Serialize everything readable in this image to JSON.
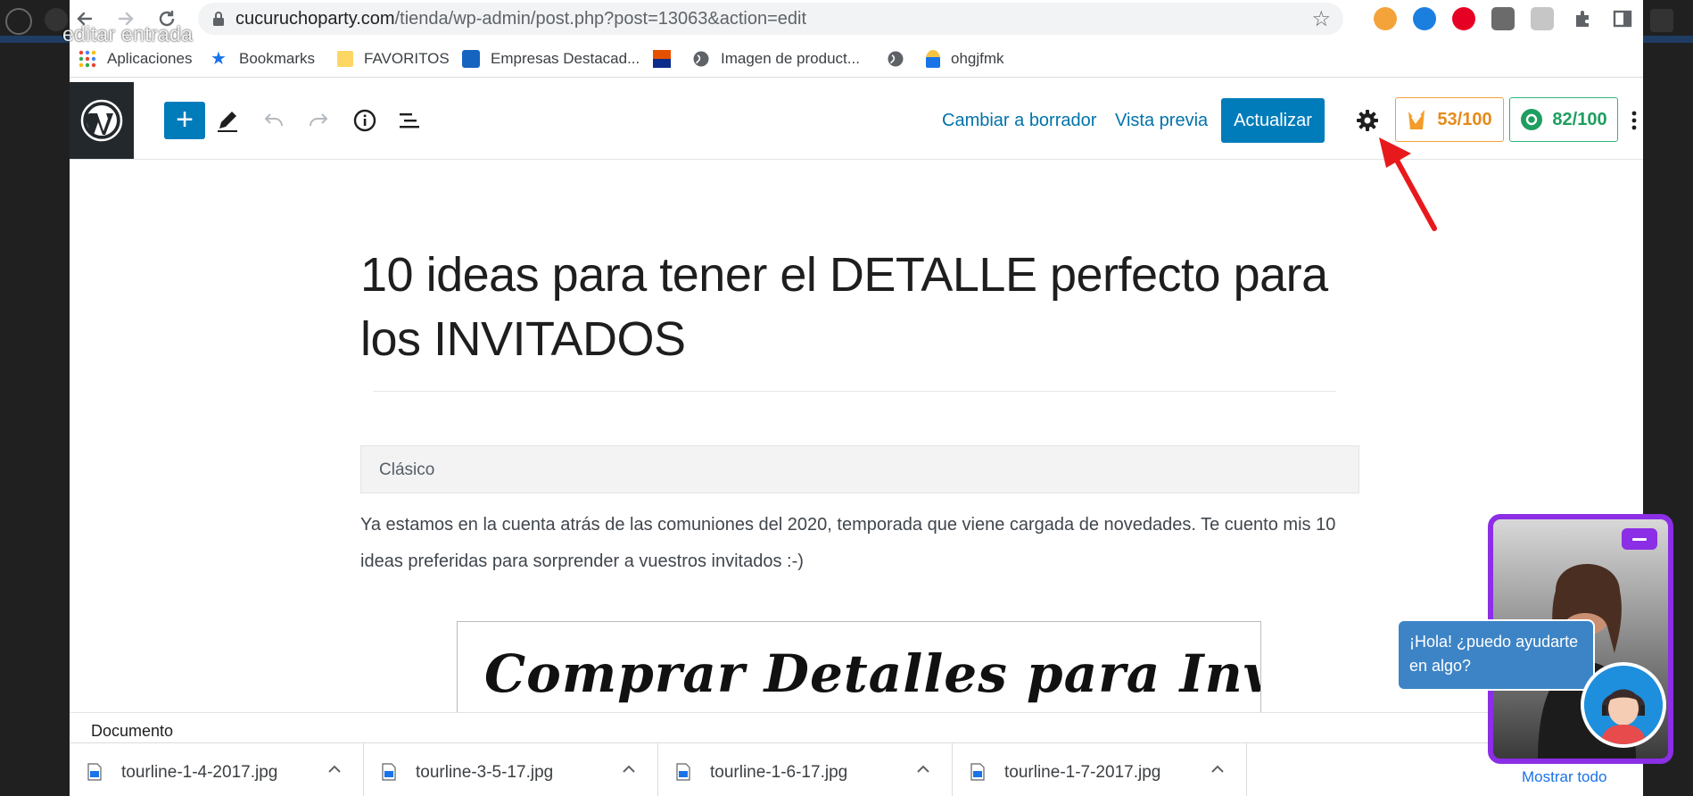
{
  "window_title_overlay": "editar entrada",
  "browser": {
    "url_host": "cucuruchoparty.com",
    "url_path": "/tienda/wp-admin/post.php?post=13063&action=edit",
    "bookmarks": [
      {
        "label": "Aplicaciones",
        "icon": "apps-grid-icon"
      },
      {
        "label": "Bookmarks",
        "icon": "star-icon"
      },
      {
        "label": "FAVORITOS",
        "icon": "folder-icon"
      },
      {
        "label": "Empresas Destacad...",
        "icon": "site-favicon-icon"
      },
      {
        "label": "",
        "icon": "orange-blue-flag-icon"
      },
      {
        "label": "Imagen de product...",
        "icon": "globe-icon"
      },
      {
        "label": "",
        "icon": "globe-icon"
      },
      {
        "label": "ohgjfmk",
        "icon": "site-favicon-icon"
      }
    ]
  },
  "editor": {
    "switch_to_draft": "Cambiar a borrador",
    "preview": "Vista previa",
    "update": "Actualizar",
    "seo_score": "53/100",
    "readability_score": "82/100",
    "post_title": "10 ideas para tener el DETALLE perfecto para los INVITADOS",
    "classic_block_label": "Clásico",
    "paragraph": "Ya estamos en la cuenta atrás de las comuniones del 2020, temporada que viene cargada de novedades. Te cuento mis 10 ideas preferidas para sorprender a vuestros invitados :-)",
    "image_text": "Comprar Detalles para Invitados",
    "breadcrumb": "Documento"
  },
  "downloads": {
    "items": [
      {
        "name": "tourline-1-4-2017.jpg"
      },
      {
        "name": "tourline-3-5-17.jpg"
      },
      {
        "name": "tourline-1-6-17.jpg"
      },
      {
        "name": "tourline-1-7-2017.jpg"
      }
    ],
    "show_all": "Mostrar todo"
  },
  "chat": {
    "bubble_text": "¡Hola! ¿puedo ayudarte en algo?"
  },
  "colors": {
    "wp_blue": "#007cba",
    "link_blue": "#0073aa",
    "seo_orange": "#e48b1c",
    "readability_green": "#1e9e60",
    "chat_purple": "#8b2ee6",
    "annotation_red": "#e8191c"
  }
}
